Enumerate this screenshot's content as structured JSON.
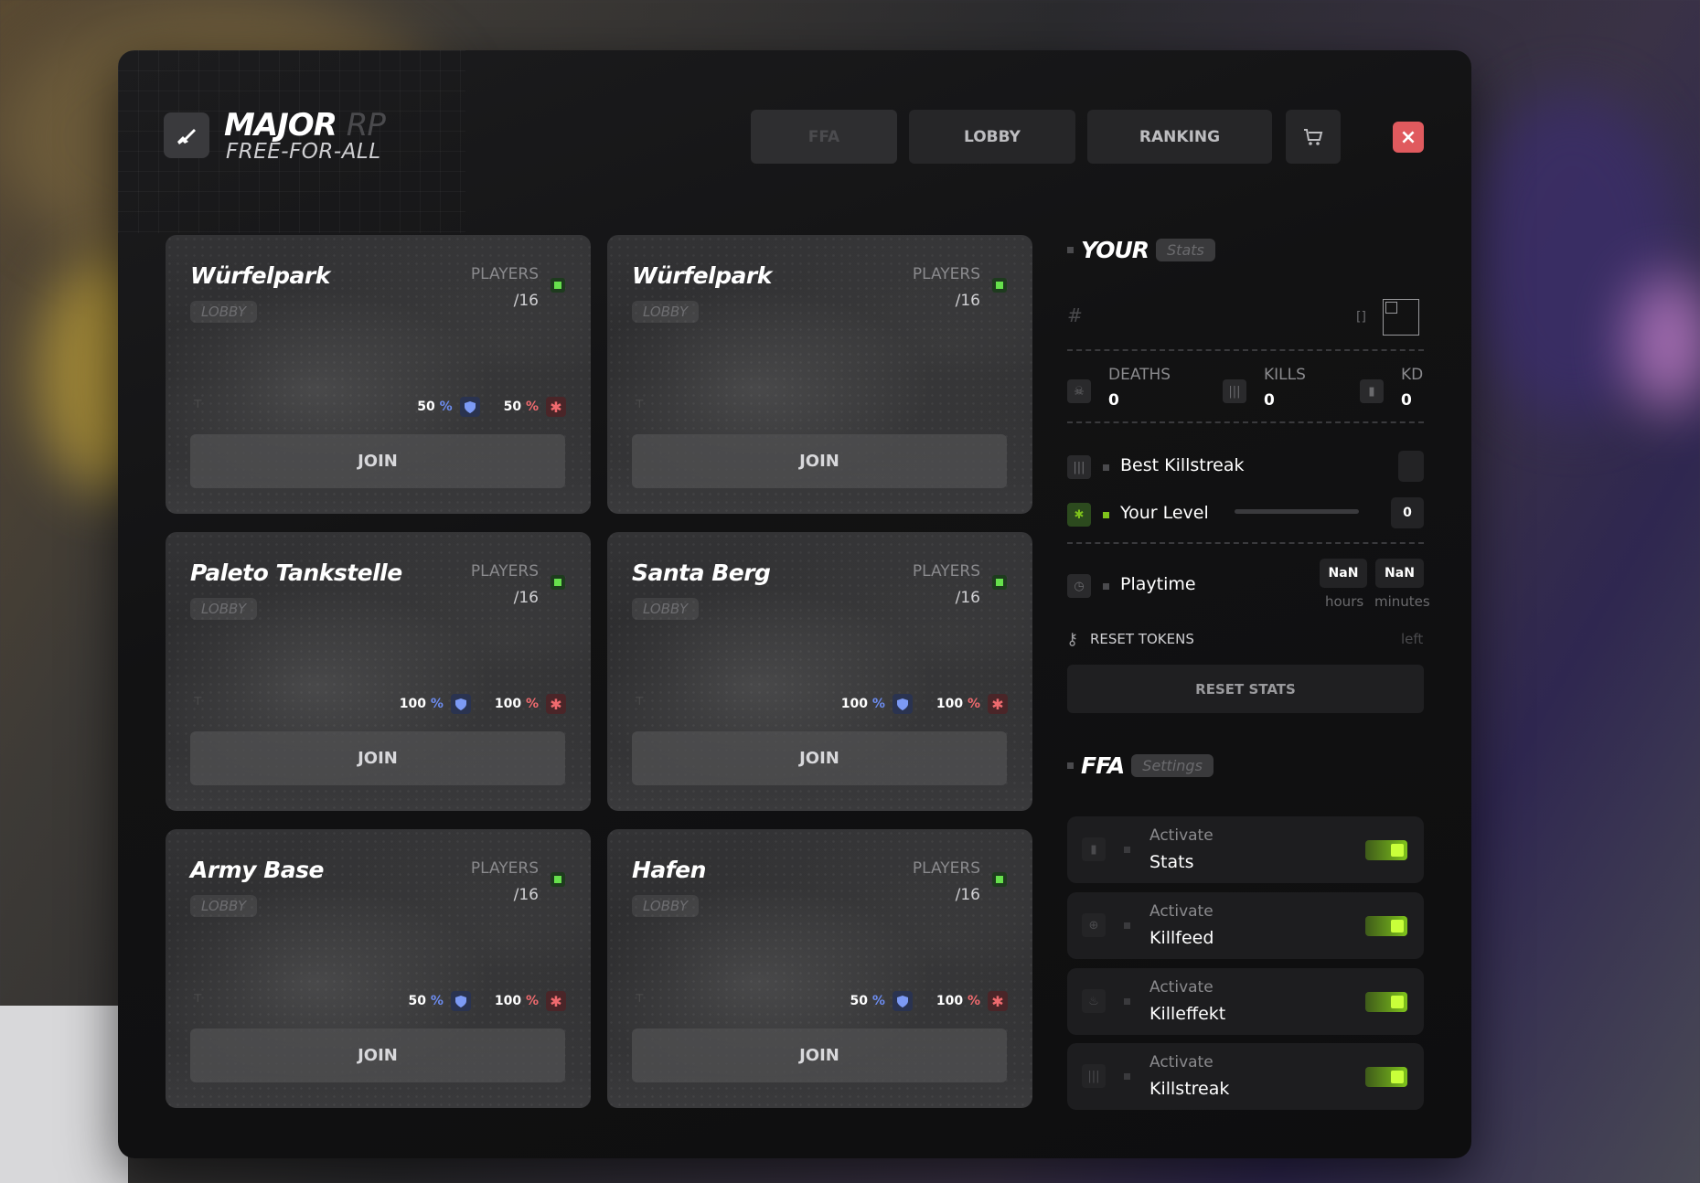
{
  "header": {
    "brand_main": "MAJOR",
    "brand_suffix": "RP",
    "brand_sub": "FREE-FOR-ALL",
    "tabs": [
      {
        "label": "FFA"
      },
      {
        "label": "LOBBY"
      },
      {
        "label": "RANKING"
      }
    ],
    "shop_icon": "cart-icon",
    "close_icon": "close-icon"
  },
  "maps": [
    {
      "name": "Würfelpark",
      "tag": "LOBBY",
      "players_label": "PLAYERS",
      "players": "/16",
      "blue_pct": "50",
      "red_pct": "50",
      "join": "JOIN"
    },
    {
      "name": "Würfelpark",
      "tag": "LOBBY",
      "players_label": "PLAYERS",
      "players": "/16",
      "blue_pct": "",
      "red_pct": "",
      "join": "JOIN"
    },
    {
      "name": "Paleto Tankstelle",
      "tag": "LOBBY",
      "players_label": "PLAYERS",
      "players": "/16",
      "blue_pct": "100",
      "red_pct": "100",
      "join": "JOIN"
    },
    {
      "name": "Santa Berg",
      "tag": "LOBBY",
      "players_label": "PLAYERS",
      "players": "/16",
      "blue_pct": "100",
      "red_pct": "100",
      "join": "JOIN"
    },
    {
      "name": "Army Base",
      "tag": "LOBBY",
      "players_label": "PLAYERS",
      "players": "/16",
      "blue_pct": "50",
      "red_pct": "100",
      "join": "JOIN"
    },
    {
      "name": "Hafen",
      "tag": "LOBBY",
      "players_label": "PLAYERS",
      "players": "/16",
      "blue_pct": "50",
      "red_pct": "100",
      "join": "JOIN"
    }
  ],
  "pct_symbol": "%",
  "stats": {
    "title": "YOUR",
    "pill": "Stats",
    "rank_hash": "#",
    "rank_brackets": "[]",
    "deaths_label": "DEATHS",
    "deaths": "0",
    "kills_label": "KILLS",
    "kills": "0",
    "kd_label": "KD",
    "kd": "0",
    "best_killstreak": "Best Killstreak",
    "your_level": "Your Level",
    "level_value": "0",
    "level_progress": 0,
    "playtime": "Playtime",
    "hours_value": "NaN",
    "hours_label": "hours",
    "minutes_value": "NaN",
    "minutes_label": "minutes",
    "reset_tokens": "RESET TOKENS",
    "reset_left": "left",
    "reset_stats": "RESET STATS"
  },
  "settings": {
    "title": "FFA",
    "pill": "Settings",
    "items": [
      {
        "small": "Activate",
        "big": "Stats",
        "icon": "bar-chart-icon",
        "enabled": true
      },
      {
        "small": "Activate",
        "big": "Killfeed",
        "icon": "crosshair-icon",
        "enabled": true
      },
      {
        "small": "Activate",
        "big": "Killeffekt",
        "icon": "flame-icon",
        "enabled": true
      },
      {
        "small": "Activate",
        "big": "Killstreak",
        "icon": "tally-icon",
        "enabled": true
      }
    ]
  },
  "colors": {
    "accent_green": "#7fc31c",
    "close_red": "#e05a5e",
    "team_blue": "#6c8cf0",
    "team_red": "#ef6a6e"
  }
}
